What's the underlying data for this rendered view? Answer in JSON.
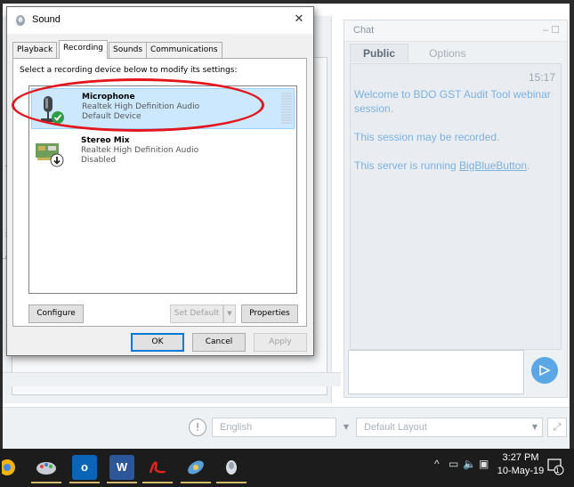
{
  "dialog": {
    "title": "Sound",
    "close_glyph": "✕",
    "tabs": [
      "Playback",
      "Recording",
      "Sounds",
      "Communications"
    ],
    "active_tab": "Recording",
    "instruction": "Select a recording device below to modify its settings:",
    "devices": [
      {
        "name": "Microphone",
        "driver": "Realtek High Definition Audio",
        "status": "Default Device",
        "icon": "microphone-icon",
        "badge": "green-check-icon",
        "selected": true
      },
      {
        "name": "Stereo Mix",
        "driver": "Realtek High Definition Audio",
        "status": "Disabled",
        "icon": "sound-card-icon",
        "badge": "down-arrow-disabled-icon",
        "selected": false
      }
    ],
    "buttons": {
      "configure": "Configure",
      "set_default": "Set Default",
      "properties": "Properties",
      "ok": "OK",
      "cancel": "Cancel",
      "apply": "Apply"
    },
    "highlight_color": "#e3161e"
  },
  "chat": {
    "title": "Chat",
    "window_controls": "– ☐",
    "tabs": [
      "Public",
      "Options"
    ],
    "time": "15:17",
    "messages": [
      "Welcome to BDO GST Audit Tool webinar session.",
      "This session may be recorded."
    ],
    "server_prefix": "This server is running ",
    "server_link": "BigBlueButton",
    "server_suffix": ".",
    "send_icon": "send-arrow-icon",
    "accent": "#5ba7e6"
  },
  "footer": {
    "help_glyph": "!",
    "language": "English",
    "layout": "Default Layout",
    "fullscreen_glyph": "⤢"
  },
  "background_fragments": {
    "left_t": "t",
    "left_s": "s",
    "left_e": "e"
  },
  "taskbar": {
    "apps": [
      {
        "icon": "chrome-icon",
        "label": ""
      },
      {
        "icon": "paint-icon",
        "label": ""
      },
      {
        "icon": "outlook-icon",
        "label": "o"
      },
      {
        "icon": "word-icon",
        "label": "W"
      },
      {
        "icon": "pdf-icon",
        "label": ""
      },
      {
        "icon": "satellite-icon",
        "label": ""
      },
      {
        "icon": "sound-app-icon",
        "label": ""
      }
    ],
    "tray": {
      "chevron": "^",
      "network": "▭",
      "volume": "🔈",
      "display": "▣"
    },
    "time": "3:27 PM",
    "date": "10-May-19",
    "notifications": "1"
  }
}
